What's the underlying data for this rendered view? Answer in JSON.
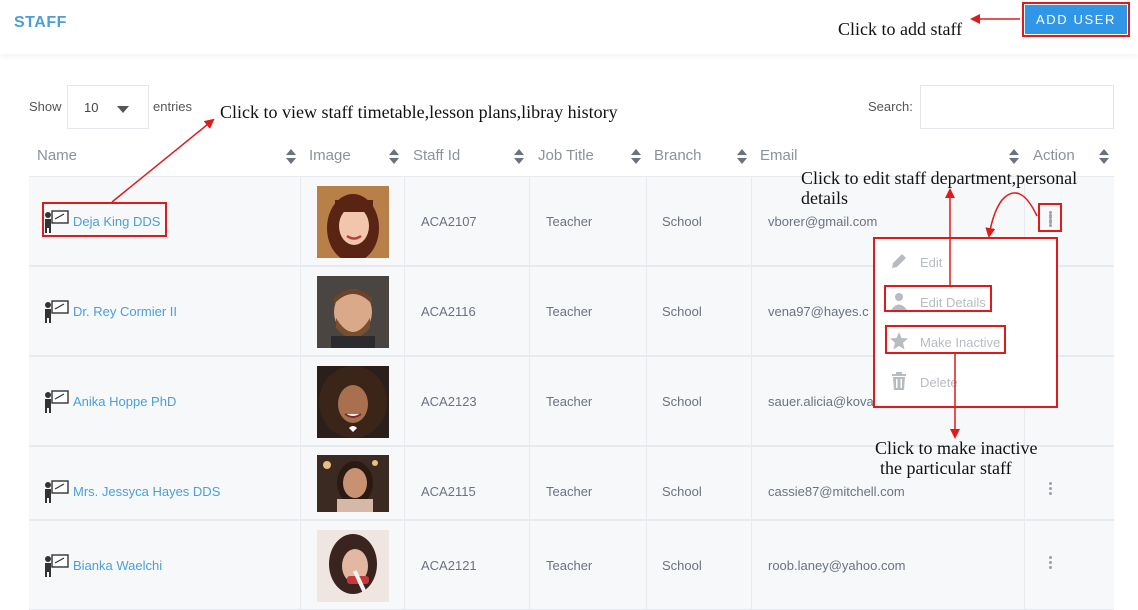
{
  "header": {
    "title": "STAFF",
    "add_button": "ADD USER"
  },
  "controls": {
    "show_label": "Show",
    "page_size": "10",
    "entries_label": "entries",
    "search_label": "Search:",
    "search_value": ""
  },
  "columns": [
    "Name",
    "Image",
    "Staff Id",
    "Job Title",
    "Branch",
    "Email",
    "Action"
  ],
  "rows": [
    {
      "name": "Deja King DDS",
      "id": "ACA2107",
      "job": "Teacher",
      "branch": "School",
      "email": "vborer@gmail.com"
    },
    {
      "name": "Dr. Rey Cormier II",
      "id": "ACA2116",
      "job": "Teacher",
      "branch": "School",
      "email": "vena97@hayes.c"
    },
    {
      "name": "Anika Hoppe PhD",
      "id": "ACA2123",
      "job": "Teacher",
      "branch": "School",
      "email": "sauer.alicia@kova"
    },
    {
      "name": "Mrs. Jessyca Hayes DDS",
      "id": "ACA2115",
      "job": "Teacher",
      "branch": "School",
      "email": "cassie87@mitchell.com"
    },
    {
      "name": "Bianka Waelchi",
      "id": "ACA2121",
      "job": "Teacher",
      "branch": "School",
      "email": "roob.laney@yahoo.com"
    }
  ],
  "action_menu": {
    "items": [
      "Edit",
      "Edit Details",
      "Make Inactive",
      "Delete"
    ]
  },
  "annotations": {
    "add_staff": "Click to add staff",
    "view_staff": "Click to view staff timetable,lesson plans,libray history",
    "edit_staff_line1": "Click to edit staff department,personal",
    "edit_staff_line2": "details",
    "inactive_line1": "Click to make inactive",
    "inactive_line2": "the particular staff"
  },
  "colors": {
    "accent": "#4a9fd8",
    "button": "#2f96e8",
    "annotation": "#e01a1a"
  }
}
